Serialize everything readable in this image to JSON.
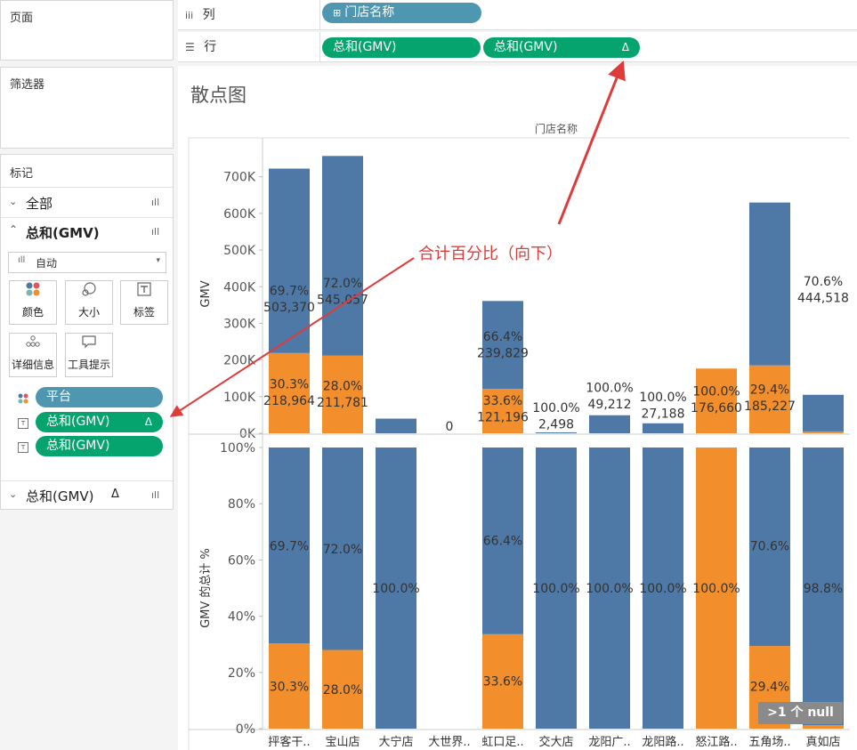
{
  "left": {
    "pages_title": "页面",
    "filters_title": "筛选器",
    "marks_title": "标记",
    "marks_all": "全部",
    "marks_gmv1": "总和(GMV)",
    "mark_type": "自动",
    "cards": [
      "颜色",
      "大小",
      "标签",
      "详细信息",
      "工具提示"
    ],
    "pills": [
      "平台",
      "总和(GMV)",
      "总和(GMV)"
    ],
    "delta": "Δ",
    "marks_gmv2": "总和(GMV)"
  },
  "shelves": {
    "columns_label": "列",
    "columns_pill": "门店名称",
    "rows_label": "行",
    "rows_pill1": "总和(GMV)",
    "rows_pill2": "总和(GMV)"
  },
  "view": {
    "title": "散点图",
    "header": "门店名称",
    "annotation": "合计百分比（向下）",
    "null_badge": ">1 个 null"
  },
  "chart_data": {
    "type": "bar",
    "categories": [
      "抨客干..",
      "宝山店",
      "大宁店",
      "大世界..",
      "虹口足..",
      "交大店",
      "龙阳广..",
      "龙阳路..",
      "怒江路..",
      "五角场..",
      "真如店"
    ],
    "colors": {
      "blue": "#4e79a7",
      "orange": "#f28e2b"
    },
    "top": {
      "ylabel": "GMV",
      "ylim": [
        0,
        760000
      ],
      "ticks": [
        0,
        100000,
        200000,
        300000,
        400000,
        500000,
        600000,
        700000
      ],
      "tick_labels": [
        "0K",
        "100K",
        "200K",
        "300K",
        "400K",
        "500K",
        "600K",
        "700K"
      ],
      "series": [
        {
          "color": "orange",
          "values": [
            218964,
            211781,
            0,
            0,
            121196,
            0,
            0,
            0,
            176660,
            185227,
            5000
          ]
        },
        {
          "color": "blue",
          "values": [
            503370,
            545057,
            40000,
            0,
            239829,
            2498,
            49212,
            27188,
            0,
            444518,
            100000
          ]
        }
      ],
      "labels": [
        {
          "i": 0,
          "text": "69.7%",
          "value": 390000
        },
        {
          "i": 0,
          "text": "503,370",
          "value": 345000
        },
        {
          "i": 1,
          "text": "72.0%",
          "value": 410000
        },
        {
          "i": 1,
          "text": "545,057",
          "value": 365000
        },
        {
          "i": 4,
          "text": "66.4%",
          "value": 265000
        },
        {
          "i": 4,
          "text": "239,829",
          "value": 220000
        },
        {
          "i": 10,
          "text": "70.6%",
          "value": 415000
        },
        {
          "i": 10,
          "text": "444,518",
          "value": 370000
        },
        {
          "i": 0,
          "text": "30.3%",
          "value": 135000
        },
        {
          "i": 0,
          "text": "218,964",
          "value": 90000
        },
        {
          "i": 1,
          "text": "28.0%",
          "value": 130000
        },
        {
          "i": 1,
          "text": "211,781",
          "value": 85000
        },
        {
          "i": 4,
          "text": "33.6%",
          "value": 90000
        },
        {
          "i": 4,
          "text": "121,196",
          "value": 45000
        },
        {
          "i": 3,
          "text": "0",
          "value": 20000
        },
        {
          "i": 5,
          "text": "100.0%",
          "value": 70000
        },
        {
          "i": 5,
          "text": "2,498",
          "value": 25000
        },
        {
          "i": 6,
          "text": "100.0%",
          "value": 125000
        },
        {
          "i": 6,
          "text": "49,212",
          "value": 80000
        },
        {
          "i": 7,
          "text": "100.0%",
          "value": 100000
        },
        {
          "i": 7,
          "text": "27,188",
          "value": 55000
        },
        {
          "i": 8,
          "text": "100.0%",
          "value": 115000
        },
        {
          "i": 8,
          "text": "176,660",
          "value": 70000
        },
        {
          "i": 9,
          "text": "29.4%",
          "value": 120000
        },
        {
          "i": 9,
          "text": "185,227",
          "value": 75000
        }
      ]
    },
    "bottom": {
      "ylabel": "GMV 的总计 %",
      "ylim": [
        0,
        100
      ],
      "ticks": [
        0,
        20,
        40,
        60,
        80,
        100
      ],
      "tick_labels": [
        "0%",
        "20%",
        "40%",
        "60%",
        "80%",
        "100%"
      ],
      "series": [
        {
          "color": "orange",
          "values": [
            30.3,
            28.0,
            0,
            0,
            33.6,
            0,
            0,
            0,
            100,
            29.4,
            1.2
          ]
        },
        {
          "color": "blue",
          "values": [
            69.7,
            72.0,
            100,
            0,
            66.4,
            100,
            100,
            100,
            0,
            70.6,
            98.8
          ]
        }
      ],
      "labels": [
        {
          "i": 0,
          "text": "69.7%",
          "value": 65
        },
        {
          "i": 1,
          "text": "72.0%",
          "value": 64
        },
        {
          "i": 4,
          "text": "66.4%",
          "value": 67
        },
        {
          "i": 9,
          "text": "70.6%",
          "value": 65
        },
        {
          "i": 2,
          "text": "100.0%",
          "value": 50
        },
        {
          "i": 5,
          "text": "100.0%",
          "value": 50
        },
        {
          "i": 6,
          "text": "100.0%",
          "value": 50
        },
        {
          "i": 7,
          "text": "100.0%",
          "value": 50
        },
        {
          "i": 8,
          "text": "100.0%",
          "value": 50
        },
        {
          "i": 10,
          "text": "98.8%",
          "value": 50
        },
        {
          "i": 0,
          "text": "30.3%",
          "value": 15
        },
        {
          "i": 1,
          "text": "28.0%",
          "value": 14
        },
        {
          "i": 4,
          "text": "33.6%",
          "value": 17
        },
        {
          "i": 9,
          "text": "29.4%",
          "value": 15
        }
      ]
    }
  }
}
